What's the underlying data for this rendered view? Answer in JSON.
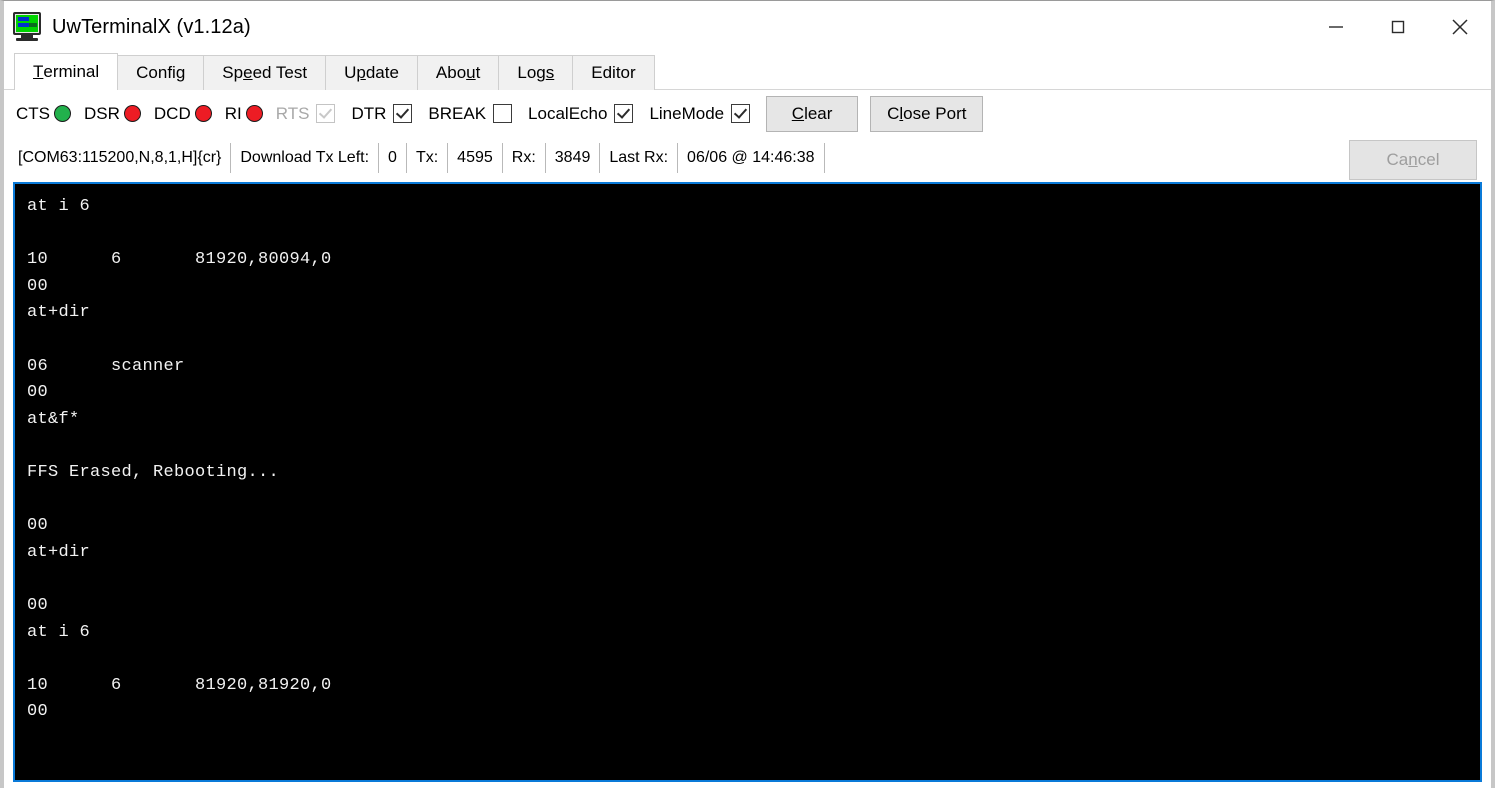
{
  "window": {
    "title": "UwTerminalX (v1.12a)",
    "icon": "crt-monitor-icon",
    "controls": {
      "minimize": "minimize-icon",
      "maximize": "maximize-icon",
      "close": "close-icon"
    }
  },
  "tabs": [
    {
      "label": "Terminal",
      "accel_index": 0,
      "active": true
    },
    {
      "label": "Config",
      "accel_index": 4,
      "active": false
    },
    {
      "label": "Speed Test",
      "accel_index": 2,
      "active": false
    },
    {
      "label": "Update",
      "accel_index": 1,
      "active": false
    },
    {
      "label": "About",
      "accel_index": 3,
      "active": false
    },
    {
      "label": "Logs",
      "accel_index": 3,
      "active": false
    },
    {
      "label": "Editor",
      "accel_index": -1,
      "active": false
    }
  ],
  "controls": {
    "leds": [
      {
        "label": "CTS",
        "state": "on",
        "color": "#22b14c"
      },
      {
        "label": "DSR",
        "state": "off",
        "color": "#ed1c24"
      },
      {
        "label": "DCD",
        "state": "off",
        "color": "#ed1c24"
      },
      {
        "label": "RI",
        "state": "off",
        "color": "#ed1c24"
      }
    ],
    "checkboxes": [
      {
        "label": "RTS",
        "checked": true,
        "enabled": false
      },
      {
        "label": "DTR",
        "checked": true,
        "enabled": true
      },
      {
        "label": "BREAK",
        "checked": false,
        "enabled": true
      },
      {
        "label": "LocalEcho",
        "checked": true,
        "enabled": true
      },
      {
        "label": "LineMode",
        "checked": true,
        "enabled": true
      }
    ],
    "buttons": {
      "clear": {
        "label": "Clear",
        "accel_index": 0,
        "enabled": true
      },
      "close_port": {
        "label": "Close Port",
        "accel_index": 1,
        "enabled": true
      }
    }
  },
  "status": {
    "port_string": "[COM63:115200,N,8,1,H]{cr}",
    "download_tx_left_label": "Download Tx Left:",
    "download_tx_left_value": "0",
    "tx_label": "Tx:",
    "tx_value": "4595",
    "rx_label": "Rx:",
    "rx_value": "3849",
    "last_rx_label": "Last Rx:",
    "last_rx_value": "06/06 @ 14:46:38",
    "cancel": {
      "label": "Cancel",
      "accel_index": 2,
      "enabled": false
    }
  },
  "terminal": {
    "foreground": "#f2f2f2",
    "background": "#000000",
    "border_color": "#0a7ad8",
    "content": "at i 6\n\n10\t6\t81920,80094,0\n00\nat+dir\n\n06\tscanner\n00\nat&f*\n\nFFS Erased, Rebooting...\n\n00\nat+dir\n\n00\nat i 6\n\n10\t6\t81920,81920,0\n00\n"
  }
}
